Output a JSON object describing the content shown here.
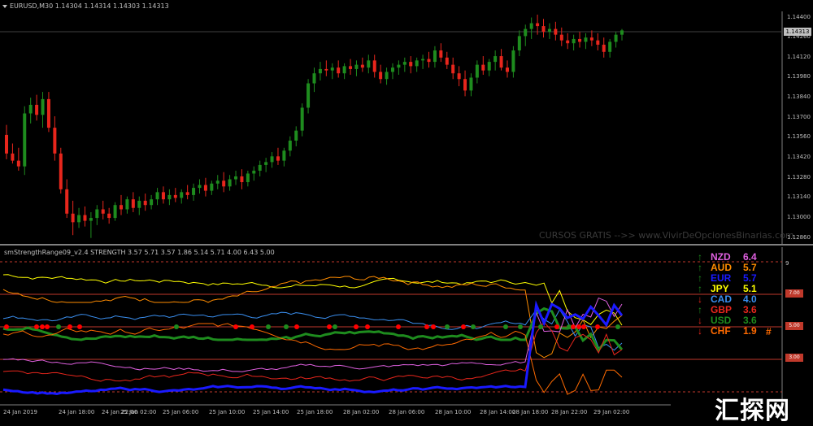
{
  "main_chart": {
    "symbol_line": "EURUSD,M30  1.14304 1.14314 1.14303 1.14313",
    "watermark": "CURSOS GRATIS -->> www.VivirDeOpcionesBinarias.com",
    "current_price": "1.14313",
    "price_labels": [
      "1.14400",
      "1.14260",
      "1.14120",
      "1.13980",
      "1.13840",
      "1.13700",
      "1.13560",
      "1.13420",
      "1.13280",
      "1.13140",
      "1.13000",
      "1.12860"
    ],
    "price_range": [
      1.1283,
      1.1442
    ],
    "candles": [
      [
        1.1358,
        1.1365,
        1.1341,
        1.1345
      ],
      [
        1.1345,
        1.1352,
        1.1338,
        1.134
      ],
      [
        1.134,
        1.1349,
        1.1333,
        1.1336
      ],
      [
        1.1336,
        1.1378,
        1.133,
        1.1373
      ],
      [
        1.1373,
        1.1384,
        1.1366,
        1.1379
      ],
      [
        1.1379,
        1.1386,
        1.1368,
        1.1372
      ],
      [
        1.1372,
        1.1388,
        1.1363,
        1.1383
      ],
      [
        1.1383,
        1.1388,
        1.136,
        1.1363
      ],
      [
        1.1363,
        1.1371,
        1.134,
        1.1345
      ],
      [
        1.1345,
        1.1349,
        1.1317,
        1.132
      ],
      [
        1.132,
        1.1327,
        1.13,
        1.1303
      ],
      [
        1.1303,
        1.1312,
        1.1288,
        1.1297
      ],
      [
        1.1297,
        1.1307,
        1.1293,
        1.1302
      ],
      [
        1.1302,
        1.1308,
        1.1294,
        1.1298
      ],
      [
        1.1298,
        1.1304,
        1.1286,
        1.13
      ],
      [
        1.13,
        1.1309,
        1.1295,
        1.1306
      ],
      [
        1.1306,
        1.1312,
        1.1299,
        1.1303
      ],
      [
        1.1303,
        1.1307,
        1.1296,
        1.13
      ],
      [
        1.13,
        1.1311,
        1.1298,
        1.1309
      ],
      [
        1.1309,
        1.1316,
        1.1302,
        1.1306
      ],
      [
        1.1306,
        1.1315,
        1.1303,
        1.1313
      ],
      [
        1.1313,
        1.1318,
        1.1304,
        1.1307
      ],
      [
        1.1307,
        1.1315,
        1.1302,
        1.1312
      ],
      [
        1.1312,
        1.1317,
        1.1305,
        1.1309
      ],
      [
        1.1309,
        1.1316,
        1.1306,
        1.1313
      ],
      [
        1.1313,
        1.1321,
        1.1309,
        1.1318
      ],
      [
        1.1318,
        1.1322,
        1.131,
        1.1313
      ],
      [
        1.1313,
        1.132,
        1.1309,
        1.1316
      ],
      [
        1.1316,
        1.1321,
        1.1311,
        1.1314
      ],
      [
        1.1314,
        1.132,
        1.131,
        1.1318
      ],
      [
        1.1318,
        1.1323,
        1.1313,
        1.1316
      ],
      [
        1.1316,
        1.1324,
        1.1312,
        1.1321
      ],
      [
        1.1321,
        1.1327,
        1.1317,
        1.1323
      ],
      [
        1.1323,
        1.1328,
        1.1315,
        1.1319
      ],
      [
        1.1319,
        1.1326,
        1.1316,
        1.1324
      ],
      [
        1.1324,
        1.133,
        1.132,
        1.1326
      ],
      [
        1.1326,
        1.1332,
        1.1318,
        1.1322
      ],
      [
        1.1322,
        1.133,
        1.1319,
        1.1327
      ],
      [
        1.1327,
        1.1333,
        1.1323,
        1.1329
      ],
      [
        1.1329,
        1.1334,
        1.132,
        1.1325
      ],
      [
        1.1325,
        1.1333,
        1.1322,
        1.1331
      ],
      [
        1.1331,
        1.1336,
        1.1326,
        1.1333
      ],
      [
        1.1333,
        1.134,
        1.1329,
        1.1337
      ],
      [
        1.1337,
        1.1342,
        1.1332,
        1.1339
      ],
      [
        1.1339,
        1.1346,
        1.1335,
        1.1343
      ],
      [
        1.1343,
        1.1349,
        1.1337,
        1.134
      ],
      [
        1.134,
        1.1349,
        1.1336,
        1.1347
      ],
      [
        1.1347,
        1.1357,
        1.1343,
        1.1354
      ],
      [
        1.1354,
        1.1364,
        1.135,
        1.1361
      ],
      [
        1.1361,
        1.138,
        1.1357,
        1.1377
      ],
      [
        1.1377,
        1.1397,
        1.1373,
        1.1394
      ],
      [
        1.1394,
        1.1405,
        1.1388,
        1.1401
      ],
      [
        1.1401,
        1.1409,
        1.1396,
        1.1404
      ],
      [
        1.1404,
        1.141,
        1.1399,
        1.1403
      ],
      [
        1.1403,
        1.1408,
        1.1397,
        1.1405
      ],
      [
        1.1405,
        1.141,
        1.1398,
        1.1401
      ],
      [
        1.1401,
        1.1408,
        1.1397,
        1.1406
      ],
      [
        1.1406,
        1.1411,
        1.14,
        1.1404
      ],
      [
        1.1404,
        1.141,
        1.1399,
        1.1407
      ],
      [
        1.1407,
        1.1412,
        1.1402,
        1.1405
      ],
      [
        1.1405,
        1.1414,
        1.1401,
        1.141
      ],
      [
        1.141,
        1.1414,
        1.1398,
        1.1402
      ],
      [
        1.1402,
        1.1407,
        1.1394,
        1.1397
      ],
      [
        1.1397,
        1.1405,
        1.1393,
        1.1402
      ],
      [
        1.1402,
        1.1408,
        1.1397,
        1.1405
      ],
      [
        1.1405,
        1.141,
        1.14,
        1.1407
      ],
      [
        1.1407,
        1.1412,
        1.1402,
        1.1409
      ],
      [
        1.1409,
        1.1413,
        1.1401,
        1.1406
      ],
      [
        1.1406,
        1.1412,
        1.1402,
        1.141
      ],
      [
        1.141,
        1.1414,
        1.1404,
        1.1411
      ],
      [
        1.1411,
        1.1416,
        1.1405,
        1.1409
      ],
      [
        1.1409,
        1.142,
        1.1405,
        1.1417
      ],
      [
        1.1417,
        1.1422,
        1.1409,
        1.1412
      ],
      [
        1.1412,
        1.1416,
        1.1404,
        1.1407
      ],
      [
        1.1407,
        1.1412,
        1.1397,
        1.1401
      ],
      [
        1.1401,
        1.1406,
        1.1392,
        1.1397
      ],
      [
        1.1397,
        1.1403,
        1.1385,
        1.1389
      ],
      [
        1.1389,
        1.1401,
        1.1385,
        1.1398
      ],
      [
        1.1398,
        1.141,
        1.1394,
        1.1407
      ],
      [
        1.1407,
        1.1413,
        1.14,
        1.1403
      ],
      [
        1.1403,
        1.1411,
        1.1399,
        1.1409
      ],
      [
        1.1409,
        1.1417,
        1.1403,
        1.1413
      ],
      [
        1.1413,
        1.1418,
        1.1403,
        1.1405
      ],
      [
        1.1405,
        1.141,
        1.1398,
        1.1402
      ],
      [
        1.1402,
        1.142,
        1.1398,
        1.1417
      ],
      [
        1.1417,
        1.1431,
        1.1413,
        1.1427
      ],
      [
        1.1427,
        1.1435,
        1.142,
        1.1432
      ],
      [
        1.1432,
        1.144,
        1.1425,
        1.1436
      ],
      [
        1.1436,
        1.1442,
        1.1428,
        1.1434
      ],
      [
        1.1434,
        1.1439,
        1.1426,
        1.143
      ],
      [
        1.143,
        1.1436,
        1.1425,
        1.1432
      ],
      [
        1.1432,
        1.1437,
        1.1424,
        1.1428
      ],
      [
        1.1428,
        1.1433,
        1.142,
        1.1424
      ],
      [
        1.1424,
        1.1429,
        1.1418,
        1.1422
      ],
      [
        1.1422,
        1.1428,
        1.1417,
        1.1425
      ],
      [
        1.1425,
        1.143,
        1.1419,
        1.1423
      ],
      [
        1.1423,
        1.1429,
        1.1418,
        1.1426
      ],
      [
        1.1426,
        1.1431,
        1.142,
        1.1424
      ],
      [
        1.1424,
        1.1429,
        1.1417,
        1.1421
      ],
      [
        1.1421,
        1.1426,
        1.1412,
        1.1416
      ],
      [
        1.1416,
        1.1425,
        1.1412,
        1.1423
      ],
      [
        1.1423,
        1.143,
        1.1419,
        1.1428
      ],
      [
        1.1428,
        1.1432,
        1.1424,
        1.1431
      ]
    ],
    "bull_color": "#1e8c1e",
    "bear_color": "#e8261c"
  },
  "indicator": {
    "header": "smStrengthRange09_v2.4 STRENGTH  3.57 5.71 3.57 1.86 5.14 5.71 4.00 6.43 5.00",
    "scale_top": "9",
    "levels": [
      "7.00",
      "5.00",
      "3.00"
    ],
    "level_color": "#c0392b"
  },
  "currencies": [
    {
      "code": "NZD",
      "value": "6.4",
      "color": "#e060e0",
      "trend": "up"
    },
    {
      "code": "AUD",
      "value": "5.7",
      "color": "#ff8c00",
      "trend": "up"
    },
    {
      "code": "EUR",
      "value": "5.7",
      "color": "#1a1aff",
      "trend": "up"
    },
    {
      "code": "JPY",
      "value": "5.1",
      "color": "#ffff00",
      "trend": "up"
    },
    {
      "code": "CAD",
      "value": "4.0",
      "color": "#3a8ff0",
      "trend": "down"
    },
    {
      "code": "GBP",
      "value": "3.6",
      "color": "#e8261c",
      "trend": "up"
    },
    {
      "code": "USD",
      "value": "3.6",
      "color": "#1e8c1e",
      "trend": "down"
    },
    {
      "code": "CHF",
      "value": "1.9",
      "color": "#ff6a00",
      "trend": "down"
    }
  ],
  "legend_hash": "#",
  "trend_colors": {
    "up": "#1e8c1e",
    "down": "#e8261c"
  },
  "time_labels": [
    "24 Jan 2019",
    "24 Jan 18:00",
    "24 Jan 22:00",
    "25 Jan 02:00",
    "25 Jan 06:00",
    "25 Jan 10:00",
    "25 Jan 14:00",
    "25 Jan 18:00",
    "28 Jan 02:00",
    "28 Jan 06:00",
    "28 Jan 10:00",
    "28 Jan 14:00",
    "28 Jan 18:00",
    "28 Jan 22:00",
    "29 Jan 02:00"
  ],
  "logo": "汇探网"
}
